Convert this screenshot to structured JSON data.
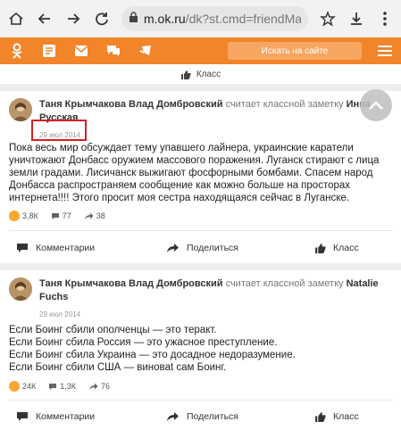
{
  "browser": {
    "url_host": "m.ok.ru",
    "url_path": "/dk?st.cmd=friendMain&s"
  },
  "toolbar": {
    "search_placeholder": "Искать на сайте"
  },
  "top_strip": {
    "klass_label": "Класс"
  },
  "posts": [
    {
      "author": "Таня Крымчакова Влад Домбровский",
      "action": "считает классной заметку",
      "target": "Инна Русская",
      "date": "29 июл 2014",
      "body": "Пока весь мир обсуждает тему упавшего лайнера, украинские каратели уничтожают Донбасс оружием массового поражения. Луганск стирают с лица земли градами. Лисичанск выжигают фосфорными бомбами. Спасем народ Донбасса распространяем сообщение как можно больше на просторах интернета!!!! Этого просит моя сестра находящаяся сейчас в Луганске.",
      "likes": "3,8К",
      "comments": "77",
      "shares": "38"
    },
    {
      "author": "Таня Крымчакова Влад Домбровский",
      "action": "считает классной заметку",
      "target": "Natalie Fuchs",
      "date": "29 июл 2014",
      "body_lines": [
        "Если Боинг сбили ополченцы — это теракт.",
        "Если Боинг сбила Россия — это ужасное преступление.",
        "Если Боинг сбила Украина — это досадное недоразумение.",
        "Если Боинг сбили США — виновat сам Боинг."
      ],
      "likes": "24К",
      "comments": "1,3К",
      "shares": "76"
    }
  ],
  "actions": {
    "comment": "Комментарии",
    "share": "Поделиться",
    "klass": "Класс"
  },
  "colors": {
    "ok_orange": "#f2842a",
    "highlight": "#d51f24"
  }
}
